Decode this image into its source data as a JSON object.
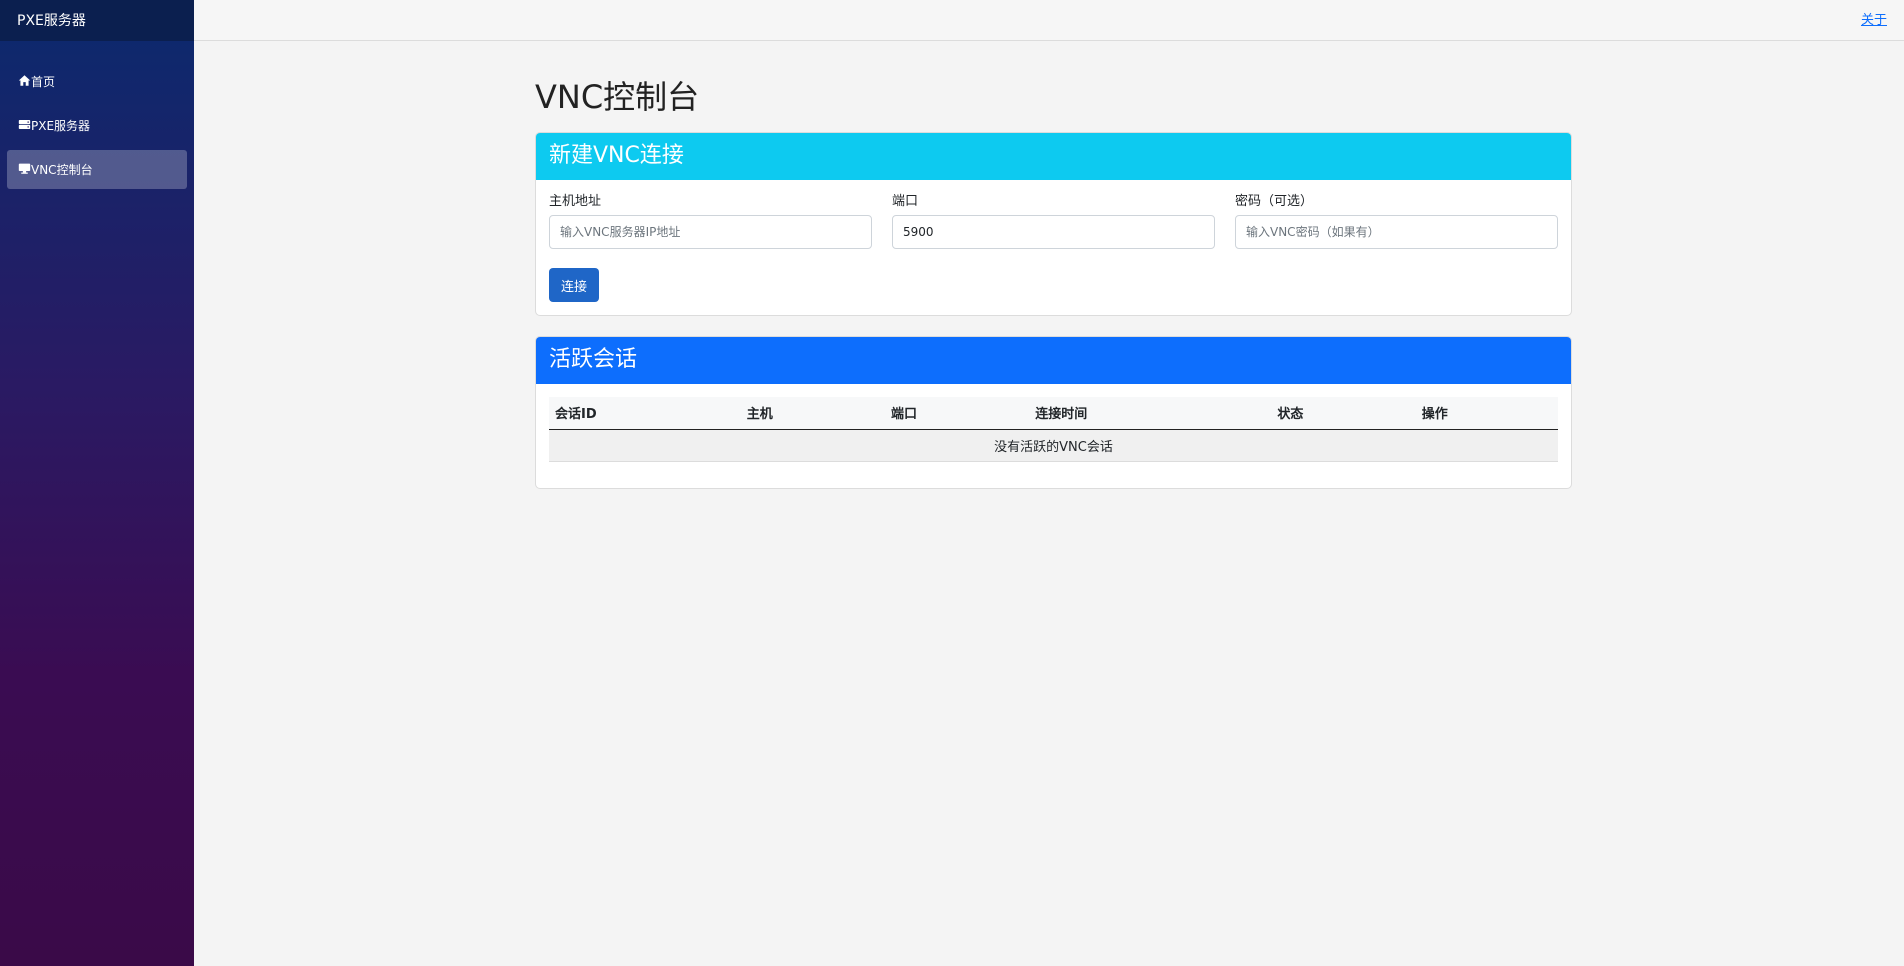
{
  "app": {
    "brand": "PXE服务器"
  },
  "sidebar": {
    "items": [
      {
        "label": "首页",
        "icon": "home-icon",
        "active": false
      },
      {
        "label": "PXE服务器",
        "icon": "server-icon",
        "active": false
      },
      {
        "label": "VNC控制台",
        "icon": "monitor-icon",
        "active": true
      }
    ]
  },
  "topbar": {
    "about": "关于"
  },
  "page": {
    "title": "VNC控制台"
  },
  "new_connection": {
    "title": "新建VNC连接",
    "host": {
      "label": "主机地址",
      "value": "",
      "placeholder": "输入VNC服务器IP地址"
    },
    "port": {
      "label": "端口",
      "value": "5900",
      "placeholder": ""
    },
    "password": {
      "label": "密码（可选）",
      "value": "",
      "placeholder": "输入VNC密码（如果有）"
    },
    "connect_button": "连接"
  },
  "sessions": {
    "title": "活跃会话",
    "columns": [
      "会话ID",
      "主机",
      "端口",
      "连接时间",
      "状态",
      "操作"
    ],
    "empty_text": "没有活跃的VNC会话"
  },
  "colors": {
    "accent_cyan": "#0dcaf0",
    "accent_blue": "#0d6efd",
    "button": "#1f66c7"
  }
}
